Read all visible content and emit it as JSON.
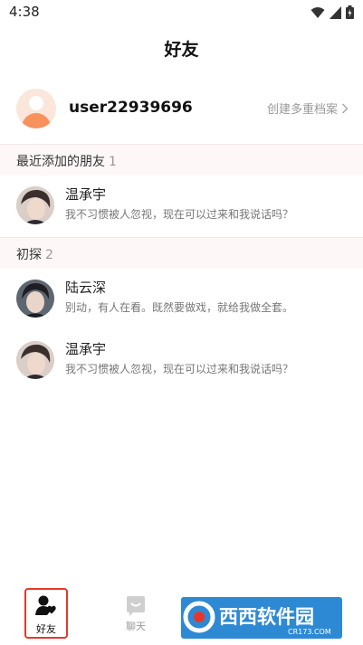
{
  "status_bar": {
    "time": "4:38"
  },
  "header": {
    "title": "好友"
  },
  "profile": {
    "username": "user22939696",
    "create_label": "创建多重档案"
  },
  "sections": [
    {
      "label": "最近添加的朋友",
      "count": "1"
    },
    {
      "label": "初探",
      "count": "2"
    }
  ],
  "friends": [
    {
      "name": "温承宇",
      "message": "我不习惯被人忽视，现在可以过来和我说话吗？"
    },
    {
      "name": "陆云深",
      "message": "别动，有人在看。既然要做戏，就给我做全套。"
    },
    {
      "name": "温承宇",
      "message": "我不习惯被人忽视，现在可以过来和我说话吗？"
    }
  ],
  "tabs": [
    {
      "label": "好友",
      "icon": "friends-icon",
      "active": true
    },
    {
      "label": "聊天",
      "icon": "chat-icon",
      "active": false
    }
  ],
  "watermark": {
    "text": "西西软件园",
    "sub": "CR173.COM"
  },
  "colors": {
    "accent": "#e23a2e",
    "section_bg": "#fdf8f7",
    "avatar_orange": "#f7925c"
  }
}
